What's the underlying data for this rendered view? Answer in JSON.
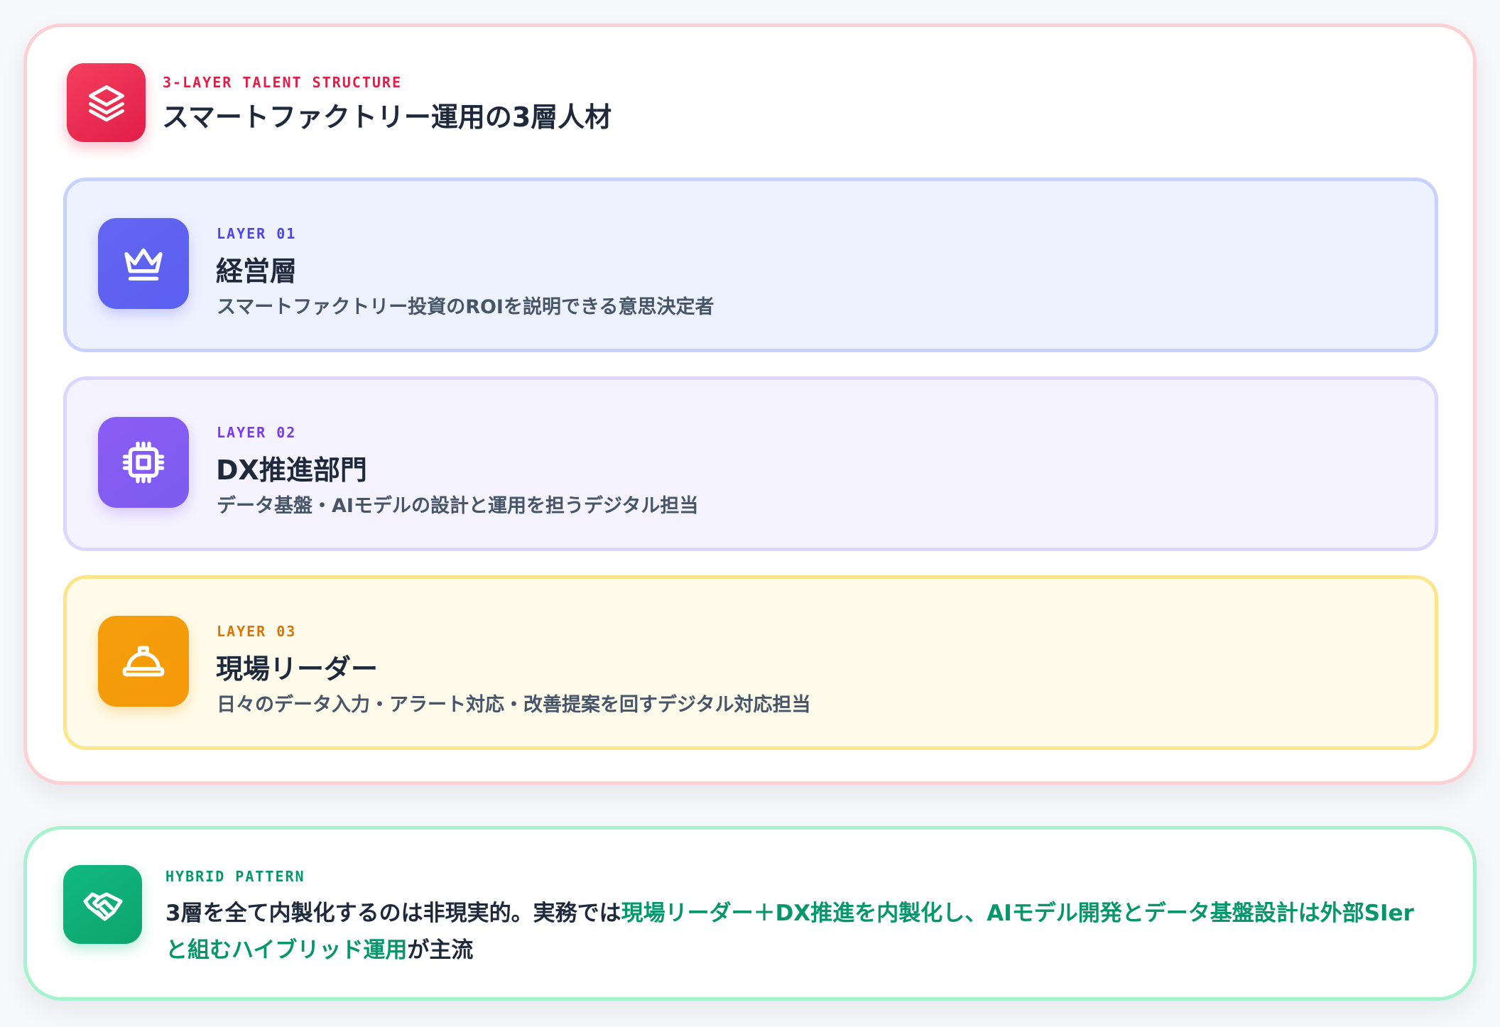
{
  "header": {
    "icon": "layers-icon",
    "eyebrow": "3-LAYER TALENT STRUCTURE",
    "title": "スマートファクトリー運用の3層人材",
    "accent_color": "#e11d48"
  },
  "layers": [
    {
      "icon": "crown-icon",
      "eyebrow": "LAYER 01",
      "title": "経営層",
      "description": "スマートファクトリー投資のROIを説明できる意思決定者",
      "accent_color": "#6366f1"
    },
    {
      "icon": "cpu-chip-icon",
      "eyebrow": "LAYER 02",
      "title": "DX推進部門",
      "description": "データ基盤・AIモデルの設計と運用を担うデジタル担当",
      "accent_color": "#8b5cf6"
    },
    {
      "icon": "hard-hat-icon",
      "eyebrow": "LAYER 03",
      "title": "現場リーダー",
      "description": "日々のデータ入力・アラート対応・改善提案を回すデジタル対応担当",
      "accent_color": "#f59e0b"
    }
  ],
  "hybrid": {
    "icon": "handshake-icon",
    "eyebrow": "HYBRID PATTERN",
    "text_lead": "3層を全て内製化するのは非現実的。実務では",
    "text_highlight": "現場リーダー＋DX推進を内製化し、AIモデル開発とデータ基盤設計は外部SIerと組むハイブリッド運用",
    "text_tail": "が主流",
    "accent_color": "#059669"
  }
}
